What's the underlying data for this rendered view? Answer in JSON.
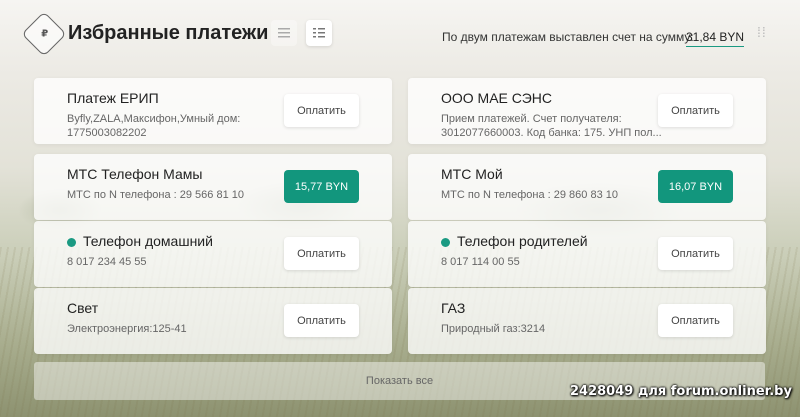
{
  "header": {
    "title": "Избранные платежи",
    "logo_glyph": "₽",
    "summary_text": "По двум платежам выставлен счет на сумму:",
    "summary_amount": "31,84 BYN",
    "list_view_icon": "list-icon",
    "grid_view_icon": "grid-icon",
    "drag_handle_icon": "drag-handle-icon"
  },
  "colors": {
    "accent": "#12967d",
    "dot": "#1a9a82"
  },
  "cards": [
    {
      "title": "Платеж ЕРИП",
      "subtitle": "Byfly,ZALA,Максифон,Умный дом: 1775003082202",
      "button": "Оплатить",
      "highlighted": false,
      "dot": false
    },
    {
      "title": "ООО МАЕ СЭНС",
      "subtitle": "Прием платежей. Счет получателя: 3012077660003. Код банка: 175. УНП пол...",
      "button": "Оплатить",
      "highlighted": false,
      "dot": false
    },
    {
      "title": "МТС Телефон Мамы",
      "subtitle": "МТС по N телефона : 29 566 81 10",
      "button": "15,77 BYN",
      "highlighted": true,
      "dot": false
    },
    {
      "title": "МТС Мой",
      "subtitle": "МТС по N телефона : 29 860 83 10",
      "button": "16,07 BYN",
      "highlighted": true,
      "dot": false
    },
    {
      "title": "Телефон домашний",
      "subtitle": "8 017 234 45 55",
      "button": "Оплатить",
      "highlighted": false,
      "dot": true
    },
    {
      "title": "Телефон родителей",
      "subtitle": "8 017 114 00 55",
      "button": "Оплатить",
      "highlighted": false,
      "dot": true
    },
    {
      "title": "Свет",
      "subtitle": "Электроэнергия:125-41",
      "button": "Оплатить",
      "highlighted": false,
      "dot": false
    },
    {
      "title": "ГАЗ",
      "subtitle": "Природный газ:3214",
      "button": "Оплатить",
      "highlighted": false,
      "dot": false
    }
  ],
  "footer": {
    "show_all": "Показать все"
  },
  "watermark": "2428049 для forum.onliner.by"
}
